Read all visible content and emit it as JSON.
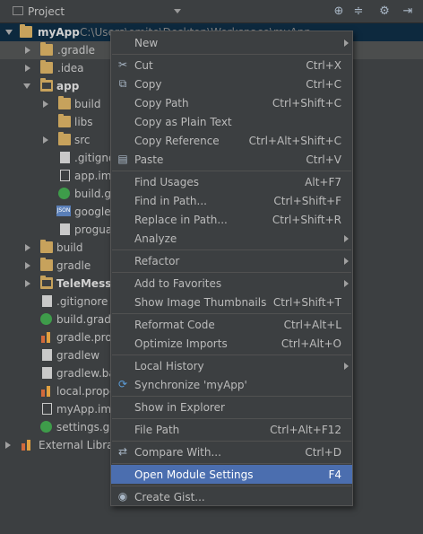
{
  "header": {
    "title": "Project"
  },
  "tree": [
    {
      "label": "myApp",
      "path": "C:\\Users\\emite\\Desktop\\Workspace\\myApp",
      "icon": "folder-icon",
      "bold": true
    },
    {
      "label": ".gradle",
      "icon": "folder-icon"
    },
    {
      "label": ".idea",
      "icon": "folder-icon"
    },
    {
      "label": "app",
      "icon": "module-folder-icon",
      "bold": true
    },
    {
      "label": "build",
      "icon": "folder-icon"
    },
    {
      "label": "libs",
      "icon": "folder-icon"
    },
    {
      "label": "src",
      "icon": "folder-icon"
    },
    {
      "label": ".gitigno",
      "icon": "file-icon"
    },
    {
      "label": "app.iml",
      "icon": "iml-file-icon"
    },
    {
      "label": "build.gr",
      "icon": "gradle-icon"
    },
    {
      "label": "google-",
      "icon": "json-icon"
    },
    {
      "label": "proguar",
      "icon": "file-icon"
    },
    {
      "label": "build",
      "icon": "folder-icon"
    },
    {
      "label": "gradle",
      "icon": "folder-icon"
    },
    {
      "label": "TeleMessag",
      "icon": "module-folder-icon",
      "bold": true
    },
    {
      "label": ".gitignore",
      "icon": "file-icon"
    },
    {
      "label": "build.gradle",
      "icon": "gradle-icon"
    },
    {
      "label": "gradle.prop",
      "icon": "properties-icon"
    },
    {
      "label": "gradlew",
      "icon": "file-icon"
    },
    {
      "label": "gradlew.bat",
      "icon": "file-icon"
    },
    {
      "label": "local.proper",
      "icon": "properties-icon"
    },
    {
      "label": "myApp.iml",
      "icon": "iml-file-icon"
    },
    {
      "label": "settings.gra",
      "icon": "gradle-icon"
    },
    {
      "label": "External Librarie",
      "icon": "library-icon"
    }
  ],
  "menu": {
    "new": {
      "label": "New"
    },
    "cut": {
      "label": "Cut",
      "shortcut": "Ctrl+X"
    },
    "copy": {
      "label": "Copy",
      "shortcut": "Ctrl+C"
    },
    "copy_path": {
      "label": "Copy Path",
      "shortcut": "Ctrl+Shift+C"
    },
    "copy_plain": {
      "label": "Copy as Plain Text"
    },
    "copy_ref": {
      "label": "Copy Reference",
      "shortcut": "Ctrl+Alt+Shift+C"
    },
    "paste": {
      "label": "Paste",
      "shortcut": "Ctrl+V"
    },
    "find_usages": {
      "label": "Find Usages",
      "shortcut": "Alt+F7"
    },
    "find_path": {
      "label": "Find in Path...",
      "shortcut": "Ctrl+Shift+F"
    },
    "replace_path": {
      "label": "Replace in Path...",
      "shortcut": "Ctrl+Shift+R"
    },
    "analyze": {
      "label": "Analyze"
    },
    "refactor": {
      "label": "Refactor"
    },
    "favorites": {
      "label": "Add to Favorites"
    },
    "thumbnails": {
      "label": "Show Image Thumbnails",
      "shortcut": "Ctrl+Shift+T"
    },
    "reformat": {
      "label": "Reformat Code",
      "shortcut": "Ctrl+Alt+L"
    },
    "optimize": {
      "label": "Optimize Imports",
      "shortcut": "Ctrl+Alt+O"
    },
    "local_history": {
      "label": "Local History"
    },
    "synchronize": {
      "label": "Synchronize 'myApp'"
    },
    "explorer": {
      "label": "Show in Explorer"
    },
    "file_path": {
      "label": "File Path",
      "shortcut": "Ctrl+Alt+F12"
    },
    "compare": {
      "label": "Compare With...",
      "shortcut": "Ctrl+D"
    },
    "module_settings": {
      "label": "Open Module Settings",
      "shortcut": "F4"
    },
    "create_gist": {
      "label": "Create Gist..."
    }
  }
}
